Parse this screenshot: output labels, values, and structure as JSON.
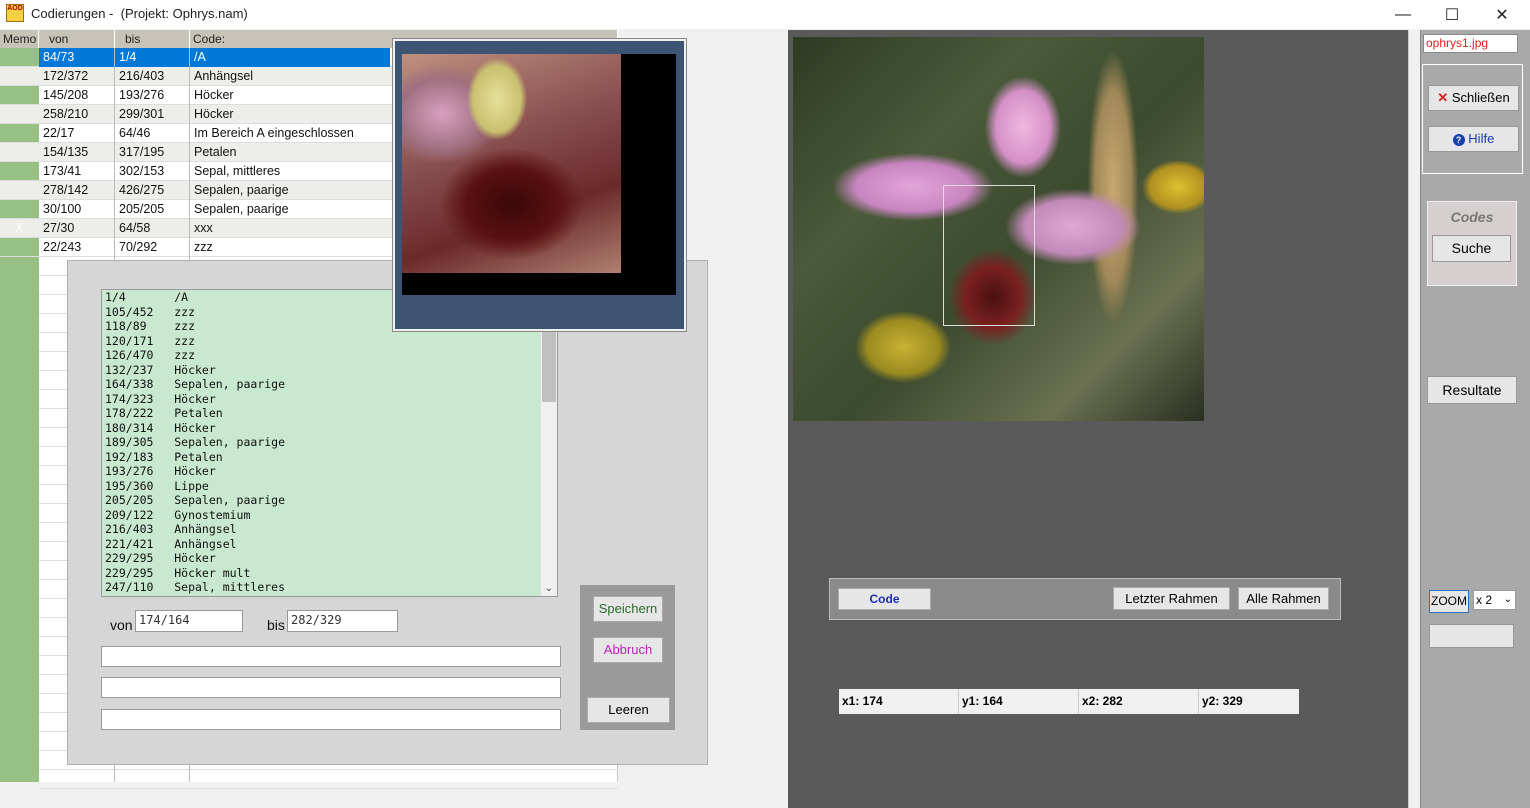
{
  "window": {
    "title": "Codierungen -  (Projekt: Ophrys.nam)",
    "minimize": "—",
    "maximize": "☐",
    "close": "✕"
  },
  "grid": {
    "headers": [
      "Memo",
      "von",
      "bis",
      "Code:"
    ],
    "rows": [
      {
        "memo": "",
        "von": "84/73",
        "bis": "1/4",
        "code": "/A"
      },
      {
        "memo": "",
        "von": "172/372",
        "bis": "216/403",
        "code": "Anhängsel"
      },
      {
        "memo": "",
        "von": "145/208",
        "bis": "193/276",
        "code": "Höcker"
      },
      {
        "memo": "",
        "von": "258/210",
        "bis": "299/301",
        "code": "Höcker"
      },
      {
        "memo": "",
        "von": "22/17",
        "bis": "64/46",
        "code": "Im Bereich A eingeschlossen"
      },
      {
        "memo": "",
        "von": "154/135",
        "bis": "317/195",
        "code": "Petalen"
      },
      {
        "memo": "",
        "von": "173/41",
        "bis": "302/153",
        "code": "Sepal, mittleres"
      },
      {
        "memo": "",
        "von": "278/142",
        "bis": "426/275",
        "code": "Sepalen, paarige"
      },
      {
        "memo": "",
        "von": "30/100",
        "bis": "205/205",
        "code": "Sepalen, paarige"
      },
      {
        "memo": "X",
        "von": "27/30",
        "bis": "64/58",
        "code": "xxx"
      },
      {
        "memo": "",
        "von": "22/243",
        "bis": "70/292",
        "code": "zzz"
      }
    ]
  },
  "editor": {
    "list": [
      "1/4       /A",
      "105/452   zzz",
      "118/89    zzz",
      "120/171   zzz",
      "126/470   zzz",
      "132/237   Höcker",
      "164/338   Sepalen, paarige",
      "174/323   Höcker",
      "178/222   Petalen",
      "180/314   Höcker",
      "189/305   Sepalen, paarige",
      "192/183   Petalen",
      "193/276   Höcker",
      "195/360   Lippe",
      "205/205   Sepalen, paarige",
      "209/122   Gynostemium",
      "216/403   Anhängsel",
      "221/421   Anhängsel",
      "229/295   Höcker",
      "229/295   Höcker mult",
      "247/110   Sepal, mittleres"
    ],
    "von_label": "von",
    "von_value": "174/164",
    "bis_label": "bis",
    "bis_value": "282/329",
    "save": "Speichern",
    "cancel": "Abbruch",
    "clear": "Leeren",
    "scroll_down": "⌄"
  },
  "image_panel": {
    "code_button": "Code",
    "last_frame": "Letzter Rahmen",
    "all_frames": "Alle Rahmen",
    "x1": "x1: 174",
    "y1": "y1: 164",
    "x2": "x2: 282",
    "y2": "y2: 329"
  },
  "sidebar": {
    "filename": "ophrys1.jpg",
    "close": "Schließen",
    "help": "Hilfe",
    "codes_title": "Codes",
    "search": "Suche",
    "results": "Resultate",
    "zoom": "ZOOM",
    "zoom_factor": "x 2",
    "close_icon": "✕",
    "help_icon": "?"
  },
  "colors": {
    "memo_green": "#96c084",
    "selection_blue": "#0078d7",
    "list_green": "#c8e8d0",
    "save_green": "#2e6b2e",
    "cancel_magenta": "#c020c0",
    "code_blue": "#1a2fb0",
    "close_red": "#e02020"
  }
}
